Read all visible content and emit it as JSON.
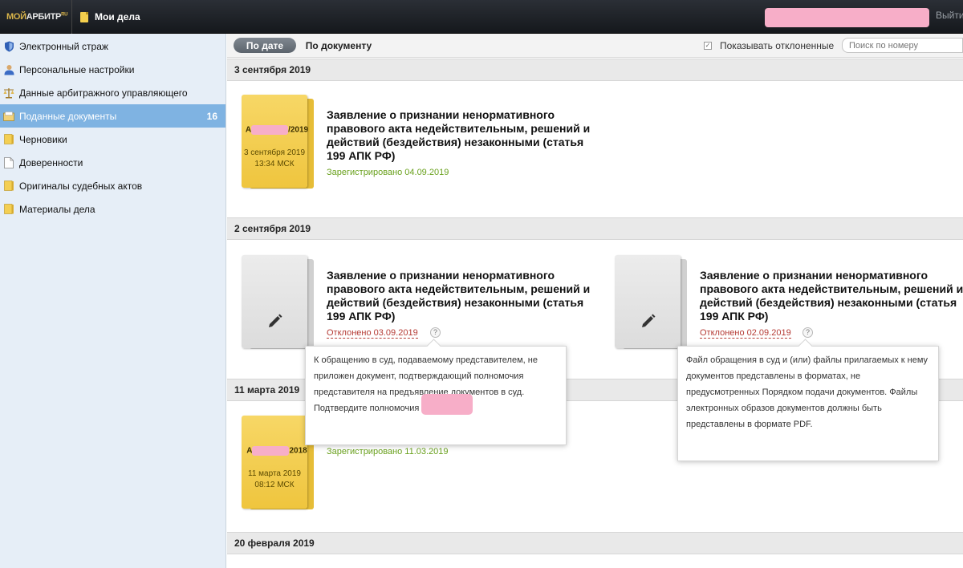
{
  "topbar": {
    "logo_a": "МОЙ",
    "logo_b": "АРБИТР",
    "logo_sup": "RU",
    "cases_label": "Мои дела",
    "logout_label": "Выйти"
  },
  "sidebar": {
    "items": [
      {
        "label": "Электронный страж",
        "icon": "shield-icon"
      },
      {
        "label": "Персональные настройки",
        "icon": "person-icon"
      },
      {
        "label": "Данные арбитражного управляющего",
        "icon": "scales-icon"
      },
      {
        "label": "Поданные документы",
        "icon": "inbox-icon",
        "count": "16",
        "active": true
      },
      {
        "label": "Черновики",
        "icon": "folder-icon"
      },
      {
        "label": "Доверенности",
        "icon": "document-icon"
      },
      {
        "label": "Оригиналы судебных актов",
        "icon": "folder-icon"
      },
      {
        "label": "Материалы дела",
        "icon": "folder-icon"
      }
    ]
  },
  "toolbar": {
    "by_date": "По дате",
    "by_document": "По документу",
    "show_rejected_label": "Показывать отклоненные",
    "show_rejected_checked": true,
    "search_placeholder": "Поиск по номеру"
  },
  "groups": [
    {
      "date": "3 сентября 2019"
    },
    {
      "date": "2 сентября 2019"
    },
    {
      "date": "11 марта 2019"
    },
    {
      "date": "20 февраля 2019"
    }
  ],
  "cards": [
    {
      "title": "Заявление о признании ненормативного правового акта недействительным, решений и действий (бездействия) незаконными (статья 199 АПК РФ)",
      "folder_prefix": "А",
      "folder_suffix": "/2019",
      "folder_date": "3 сентября 2019",
      "folder_time": "13:34 МСК",
      "status": "Зарегистрировано 04.09.2019"
    },
    {
      "title": "Заявление о признании ненормативного правового акта недействительным, решений и действий (бездействия) незаконными (статья 199 АПК РФ)",
      "status": "Отклонено 03.09.2019",
      "help": "?"
    },
    {
      "title": "Заявление о признании ненормативного правового акта недействительным, решений и действий (бездействия) незаконными (статья 199 АПК РФ)",
      "status": "Отклонено 02.09.2019",
      "help": "?"
    },
    {
      "folder_prefix": "А",
      "folder_suffix": "2018",
      "folder_date": "11 марта 2019",
      "folder_time": "08:12 МСК",
      "status": "Зарегистрировано 11.03.2019"
    }
  ],
  "tooltips": {
    "reason_1": "К обращению в суд, подаваемому представителем, не приложен документ, подтверждающий полномочия представителя на предъявление документов в суд. Подтвердите полномочия",
    "reason_2": "Файл обращения в суд и (или) файлы прилагаемых к нему документов представлены в форматах, не предусмотренных Порядком подачи документов. Файлы электронных образов документов должны быть представлены в формате PDF."
  },
  "colors": {
    "sidebar_bg": "#e6eef7",
    "active_item": "#7fb3e2",
    "status_ok": "#6aa11e",
    "status_rejected": "#b53b35",
    "folder_yellow": "#f2cb4a"
  }
}
